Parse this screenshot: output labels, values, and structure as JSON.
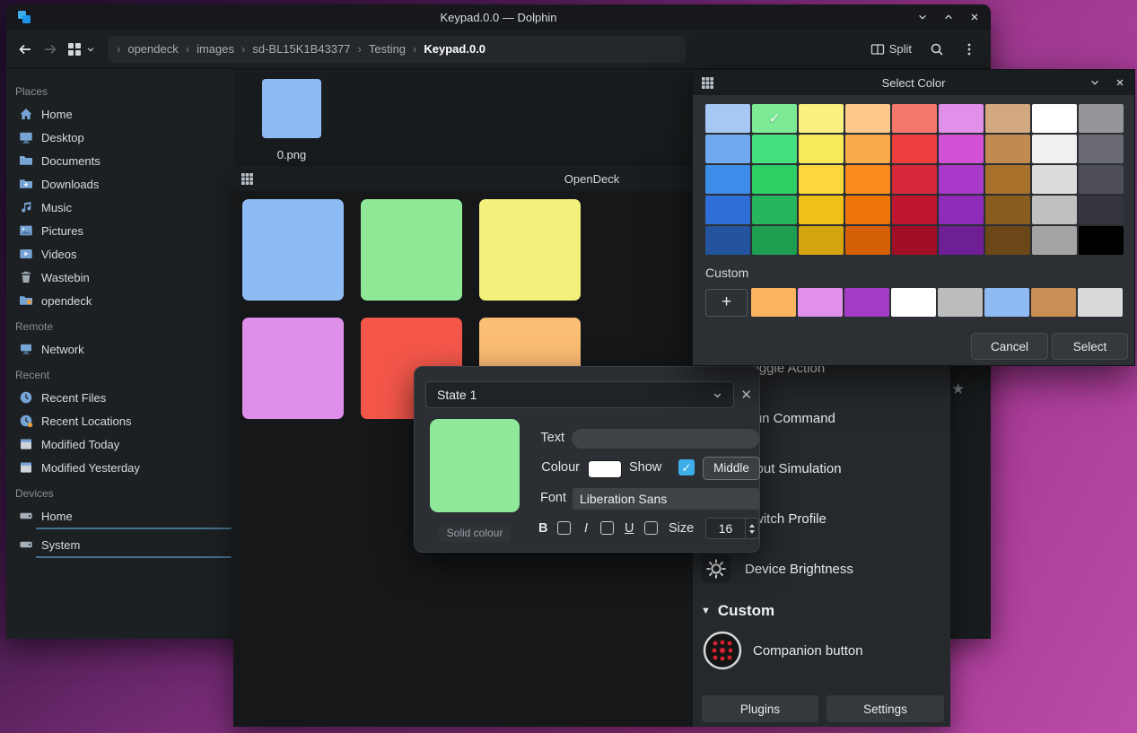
{
  "window": {
    "title": "Keypad.0.0 — Dolphin"
  },
  "toolbar": {
    "breadcrumb": [
      "opendeck",
      "images",
      "sd-BL15K1B43377",
      "Testing",
      "Keypad.0.0"
    ],
    "split_label": "Split"
  },
  "sidebar": {
    "sections": [
      {
        "label": "Places",
        "items": [
          {
            "label": "Home",
            "icon": "home"
          },
          {
            "label": "Desktop",
            "icon": "desktop"
          },
          {
            "label": "Documents",
            "icon": "documents"
          },
          {
            "label": "Downloads",
            "icon": "downloads"
          },
          {
            "label": "Music",
            "icon": "music"
          },
          {
            "label": "Pictures",
            "icon": "pictures"
          },
          {
            "label": "Videos",
            "icon": "videos"
          },
          {
            "label": "Wastebin",
            "icon": "trash"
          },
          {
            "label": "opendeck",
            "icon": "folder-orange"
          }
        ]
      },
      {
        "label": "Remote",
        "items": [
          {
            "label": "Network",
            "icon": "network"
          }
        ]
      },
      {
        "label": "Recent",
        "items": [
          {
            "label": "Recent Files",
            "icon": "clock"
          },
          {
            "label": "Recent Locations",
            "icon": "clock-pin"
          },
          {
            "label": "Modified Today",
            "icon": "calendar"
          },
          {
            "label": "Modified Yesterday",
            "icon": "calendar"
          }
        ]
      },
      {
        "label": "Devices",
        "items": [
          {
            "label": "Home",
            "icon": "drive",
            "bar": true
          },
          {
            "label": "System",
            "icon": "drive",
            "bar": true
          }
        ]
      }
    ]
  },
  "files": [
    {
      "name": "0.png",
      "color": "#8fbbf5"
    }
  ],
  "opendeck": {
    "title": "OpenDeck",
    "grid_buttons": [
      "#8fbbf5",
      "#90e996",
      "#f5f07c",
      "#de8fe9",
      "#f4574a",
      "#fcbd74"
    ],
    "actions": [
      {
        "label": "Toggle Action",
        "icon": "toggle"
      },
      {
        "label": "Run Command",
        "icon": "command"
      },
      {
        "label": "Input Simulation",
        "icon": "keyboard"
      },
      {
        "label": "Switch Profile",
        "icon": "profile"
      },
      {
        "label": "Device Brightness",
        "icon": "brightness"
      }
    ],
    "custom_header": "Custom",
    "companion_label": "Companion button",
    "plugins_button": "Plugins",
    "settings_button": "Settings"
  },
  "state_dialog": {
    "state_value": "State 1",
    "preview_color": "#90e89b",
    "preview_caption": "Solid colour",
    "text_label": "Text",
    "text_value": "",
    "colour_label": "Colour",
    "colour_value": "#ffffff",
    "show_label": "Show",
    "show_checked": true,
    "middle_button": "Middle",
    "font_label": "Font",
    "font_value": "Liberation Sans",
    "bold_label": "B",
    "italic_label": "I",
    "underline_label": "U",
    "size_label": "Size",
    "size_value": "16"
  },
  "color_dialog": {
    "title": "Select Color",
    "palette": [
      [
        "#a6c8f5",
        "#7deb96",
        "#f9f180",
        "#fdc98b",
        "#f4786c",
        "#e090e8",
        "#d2a97f",
        "#ffffff",
        "#95959a"
      ],
      [
        "#70a9f0",
        "#47e07e",
        "#f8e959",
        "#fbab4b",
        "#ee3e3e",
        "#d24fd8",
        "#c18a4f",
        "#f0f0f0",
        "#6a6a72"
      ],
      [
        "#3e8ce9",
        "#2ed066",
        "#fbd73b",
        "#f98b1c",
        "#d62839",
        "#a839c9",
        "#a8722c",
        "#dcdcdc",
        "#4e4e58"
      ],
      [
        "#2d6fd6",
        "#26b45c",
        "#f0bf18",
        "#ef7508",
        "#c0152f",
        "#8e2bb8",
        "#8a5c20",
        "#c0c0c0",
        "#35343f"
      ],
      [
        "#24549e",
        "#1e9e50",
        "#d4a50e",
        "#d45f04",
        "#a10f26",
        "#6f1f96",
        "#6b4717",
        "#a4a4a4",
        "#000000"
      ]
    ],
    "selected_cell": {
      "row": 0,
      "col": 1
    },
    "custom_label": "Custom",
    "custom_colors": [
      "#fbb35e",
      "#e090e8",
      "#a43bc6",
      "#ffffff",
      "#bcbcbc",
      "#8fbbf5",
      "#c98e54",
      "#dadada"
    ],
    "cancel_button": "Cancel",
    "select_button": "Select"
  }
}
